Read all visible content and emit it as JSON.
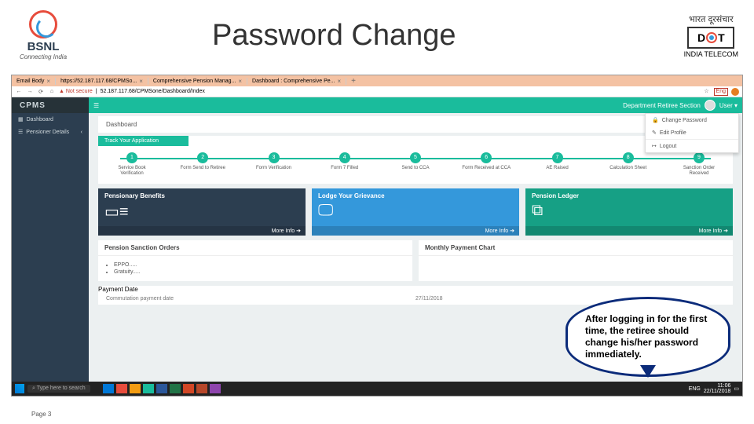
{
  "slide": {
    "title": "Password Change",
    "bsnl_name": "BSNL",
    "bsnl_tag": "Connecting India",
    "dot_hindi": "भारत दूरसंचार",
    "dot_text_d": "D",
    "dot_text_t": "T",
    "dot_sub": "INDIA TELECOM",
    "page_num": "Page 3"
  },
  "browser": {
    "tabs": [
      "Email Body",
      "https://52.187.117.68/CPMSo...",
      "Comprehensive Pension Manag...",
      "Dashboard : Comprehensive Pe..."
    ],
    "not_secure": "Not secure",
    "url": "52.187.117.68/CPMSone/Dashboard/Index",
    "lang": "Eng"
  },
  "app": {
    "brand": "CPMS",
    "sidenav": {
      "dashboard": "Dashboard",
      "pension": "Pensioner Details"
    },
    "top_section": "Department Retiree Section",
    "top_user": "User",
    "usermenu": {
      "change": "Change Password",
      "edit": "Edit Profile",
      "logout": "Logout"
    },
    "breadcrumb": "Dashboard",
    "progress_title": "Track Your Application",
    "steps": [
      {
        "n": "1",
        "l": "Service Book\nVerification"
      },
      {
        "n": "2",
        "l": "Form Send to\nRetiree"
      },
      {
        "n": "3",
        "l": "Form\nVerification"
      },
      {
        "n": "4",
        "l": "Form 7 Filled"
      },
      {
        "n": "5",
        "l": "Send to CCA"
      },
      {
        "n": "6",
        "l": "Form Received\nat CCA"
      },
      {
        "n": "7",
        "l": "AE Raised"
      },
      {
        "n": "8",
        "l": "Calculation\nSheet"
      },
      {
        "n": "9",
        "l": "Sanction Order\nReceived"
      }
    ],
    "tiles": {
      "t1": "Pensionary Benefits",
      "t2": "Lodge Your Grievance",
      "t3": "Pension Ledger",
      "more": "More Info"
    },
    "panel1_title": "Pension Sanction Orders",
    "panel1_items": [
      "EPPO.....",
      "Gratuity....."
    ],
    "panel2_title": "Monthly Payment Chart",
    "pay_title": "Payment Date",
    "pay_k": "Commutation payment date",
    "pay_v": "27/11/2018"
  },
  "taskbar": {
    "search": "Type here to search",
    "time": "11:06",
    "date": "22/11/2018",
    "lang": "ENG"
  },
  "callout": "After logging in for the first time, the retiree should change his/her password immediately."
}
